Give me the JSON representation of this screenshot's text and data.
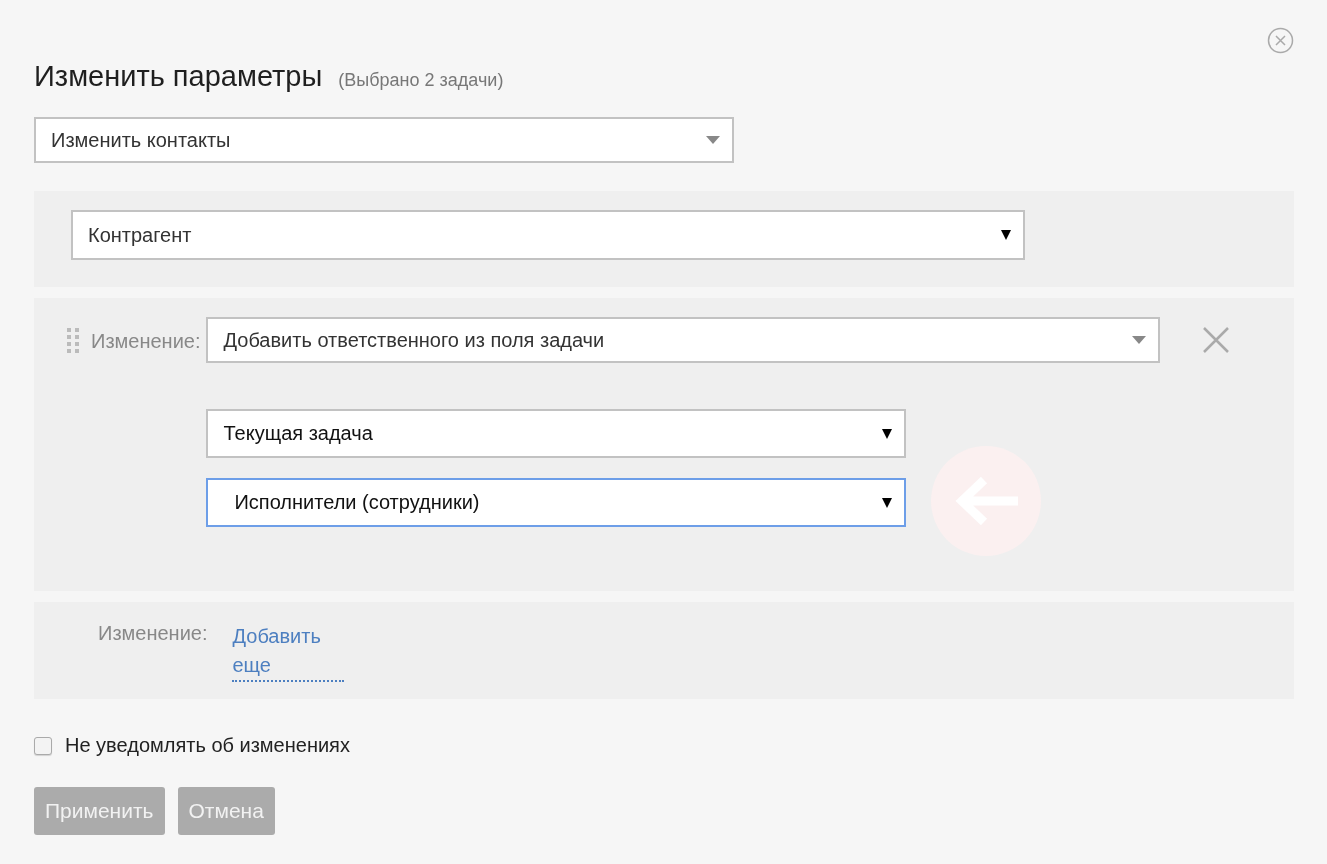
{
  "dialog": {
    "title": "Изменить параметры",
    "subtitle": "(Выбрано 2 задачи)"
  },
  "action_select": {
    "kind": "custom",
    "value": "Изменить контакты"
  },
  "counterparty_select": {
    "kind": "native",
    "value": "Контрагент"
  },
  "changes": [
    {
      "label": "Изменение:",
      "select": {
        "kind": "custom",
        "value": "Добавить ответственного из поля задачи"
      },
      "sub_selects": [
        {
          "kind": "native",
          "value": "Текущая задача",
          "focused": false
        },
        {
          "kind": "native",
          "value": "Исполнители (сотрудники)",
          "focused": true
        }
      ]
    }
  ],
  "add_change": {
    "label": "Изменение:",
    "link": "Добавить еще"
  },
  "notify_checkbox": {
    "label": "Не уведомлять об изменениях",
    "checked": false
  },
  "buttons": [
    {
      "label": "Применить",
      "disabled": true
    },
    {
      "label": "Отмена",
      "disabled": true
    }
  ]
}
